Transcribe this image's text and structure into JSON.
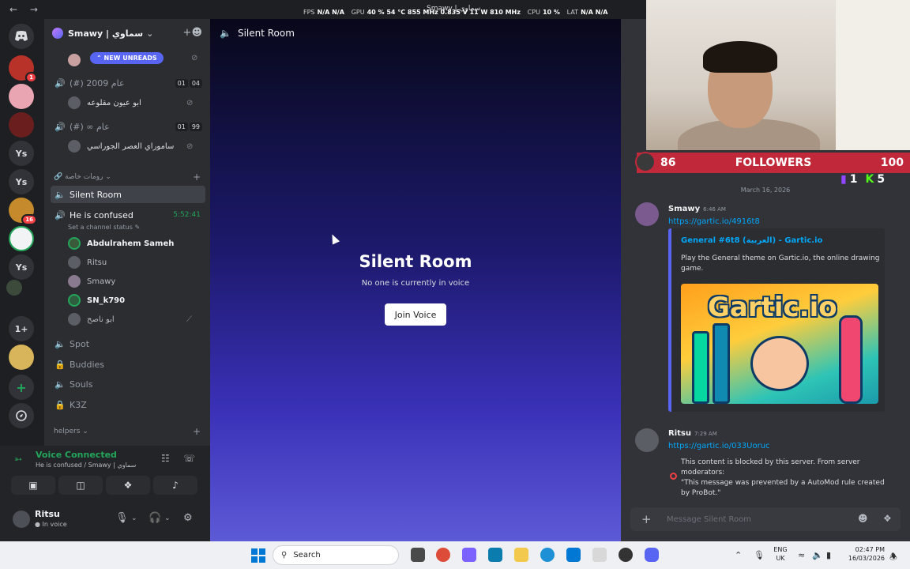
{
  "overlay": {
    "fps_label": "FPS",
    "fps_value": "N/A N/A",
    "gpu_label": "GPU",
    "gpu_value": "40 % 54 °C 855 MHz 0.835 V 11 W 810 MHz",
    "cpu_label": "CPU",
    "cpu_value": "10 %",
    "lat_label": "LAT",
    "lat_value": "N/A N/A",
    "window_title": "Smawy | سماوي"
  },
  "rail": {
    "items": [
      {
        "label": "",
        "badge": ""
      },
      {
        "label": "",
        "badge": "1"
      },
      {
        "label": "",
        "badge": ""
      },
      {
        "label": "",
        "badge": ""
      },
      {
        "label": "Ys",
        "badge": ""
      },
      {
        "label": "Ys",
        "badge": ""
      },
      {
        "label": "",
        "badge": "16"
      },
      {
        "label": "",
        "badge": ""
      },
      {
        "label": "Ys",
        "badge": ""
      },
      {
        "label": "",
        "badge": ""
      },
      {
        "label": "1+",
        "badge": ""
      },
      {
        "label": "",
        "badge": ""
      },
      {
        "label": "+",
        "badge": ""
      },
      {
        "label": "",
        "badge": ""
      }
    ]
  },
  "server": {
    "name": "Smawy | سماوي",
    "new_unreads": "NEW UNREADS"
  },
  "channels": {
    "c1_name": "(#) 2009 عام",
    "c1_counts": [
      "01",
      "04"
    ],
    "c1_member": "ابو عيون مقلوعه",
    "c2_name": "(#) ∞ عام",
    "c2_counts": [
      "01",
      "99"
    ],
    "c2_member": "ساموراي العصر الجوراسي",
    "category_private": "رومات خاصة",
    "silent_room": "Silent Room",
    "confused": "He is confused",
    "confused_timer": "5:52:41",
    "set_status": "Set a channel status",
    "members": [
      "Abdulrahem Sameh",
      "Ritsu",
      "Smawy",
      "SN_k790",
      "ابو ناصح"
    ],
    "spot": "Spot",
    "buddies": "Buddies",
    "souls": "Souls",
    "k3z": "K3Z",
    "category_helpers": "helpers"
  },
  "voice": {
    "title": "Voice Connected",
    "subtitle": "He is confused / Smawy | سماوي"
  },
  "user": {
    "name": "Ritsu",
    "status": "In voice"
  },
  "stage": {
    "header": "Silent Room",
    "title": "Silent Room",
    "subtitle": "No one is currently in voice",
    "join_label": "Join Voice"
  },
  "stream_overlay": {
    "left_count": "86",
    "label": "FOLLOWERS",
    "right_count": "100",
    "twitch_count": "1",
    "kick_count": "5"
  },
  "chat": {
    "date": "March 16, 2026",
    "messages": [
      {
        "author": "Smawy",
        "time": "6:46 AM",
        "link": "https://gartic.io/4916t8",
        "embed_title": "General #6t8 (العربية) - Gartic.io",
        "embed_desc": "Play the General theme on Gartic.io, the online drawing game.",
        "embed_logo": "Gartic.io"
      },
      {
        "author": "Ritsu",
        "time": "7:29 AM",
        "link": "https://gartic.io/033Uoruc",
        "blocked_text": "This content is blocked by this server. From server moderators:",
        "blocked_quote": "\"This message was prevented by a AutoMod rule created by ProBot.\""
      }
    ],
    "composer_placeholder": "Message Silent Room"
  },
  "taskbar": {
    "search_label": "Search",
    "lang_top": "ENG",
    "lang_bottom": "UK",
    "time": "02:47 PM",
    "date": "16/03/2026"
  },
  "colors": {
    "accent": "#5865f2",
    "voice_green": "#23a55a",
    "link": "#00a8fc",
    "danger": "#f23f43",
    "followers_bar": "#c1283a"
  }
}
